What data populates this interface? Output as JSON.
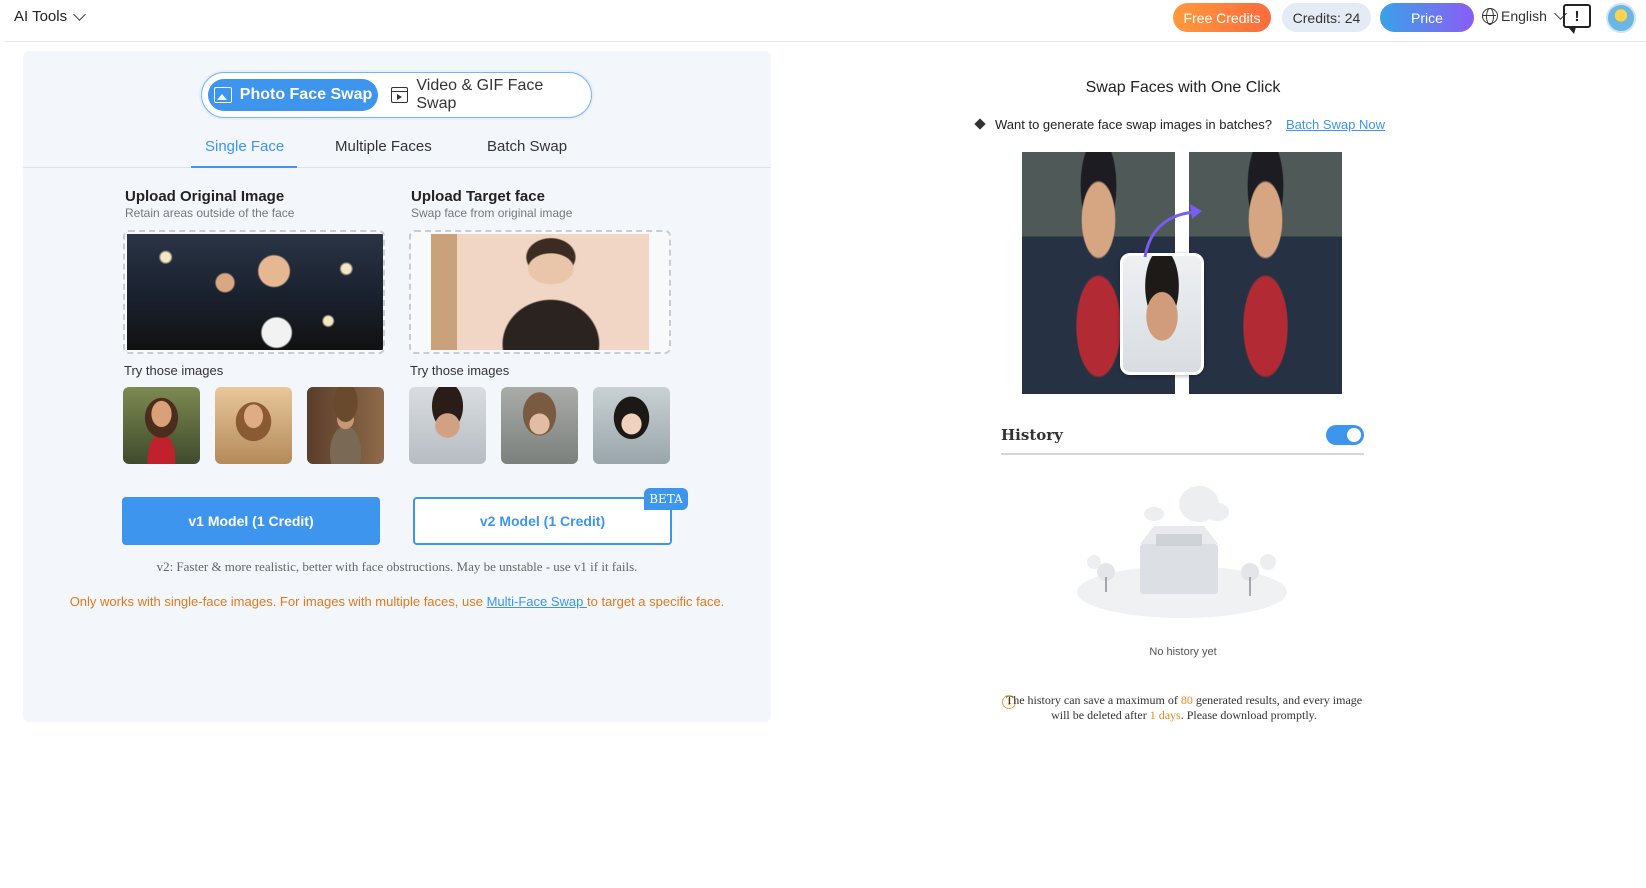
{
  "header": {
    "ai_tools_label": "AI Tools",
    "free_credits_label": "Free Credits",
    "credits_label": "Credits: 24",
    "price_label": "Price",
    "language_label": "English",
    "feedback_glyph": "!"
  },
  "mode_switch": {
    "photo_label": "Photo Face Swap",
    "video_label": "Video & GIF Face Swap"
  },
  "tabs": [
    {
      "label": "Single Face",
      "active": true
    },
    {
      "label": "Multiple Faces",
      "active": false
    },
    {
      "label": "Batch Swap",
      "active": false
    }
  ],
  "upload": {
    "original": {
      "title": "Upload Original Image",
      "subtitle": "Retain areas outside of the face",
      "try_label": "Try those images"
    },
    "target": {
      "title": "Upload Target face",
      "subtitle": "Swap face from original image",
      "try_label": "Try those images"
    }
  },
  "buttons": {
    "v1_label": "v1 Model (1 Credit)",
    "v2_label": "v2 Model (1 Credit)",
    "beta_badge": "BETA"
  },
  "notes": {
    "v2_note": "v2: Faster & more realistic, better with face obstructions. May be unstable - use v1 if it fails.",
    "warn_before": "Only works with single-face images. For images with multiple faces, use ",
    "warn_link": "Multi-Face Swap ",
    "warn_after": "to target a specific face."
  },
  "right": {
    "title": "Swap Faces with One Click",
    "batch_text": "Want to generate face swap images in batches?",
    "batch_link": "Batch Swap Now"
  },
  "history": {
    "title": "History",
    "toggle_on": true,
    "empty_text": "No history yet",
    "note_part1": "The history can save a maximum of ",
    "note_max": "80",
    "note_part2": " generated results, and every image will be deleted after ",
    "note_days": "1 days",
    "note_part3": ". Please download promptly."
  },
  "colors": {
    "accent": "#3d95ee",
    "warning": "#e07a1f",
    "panel_bg": "#f3f6fa"
  }
}
